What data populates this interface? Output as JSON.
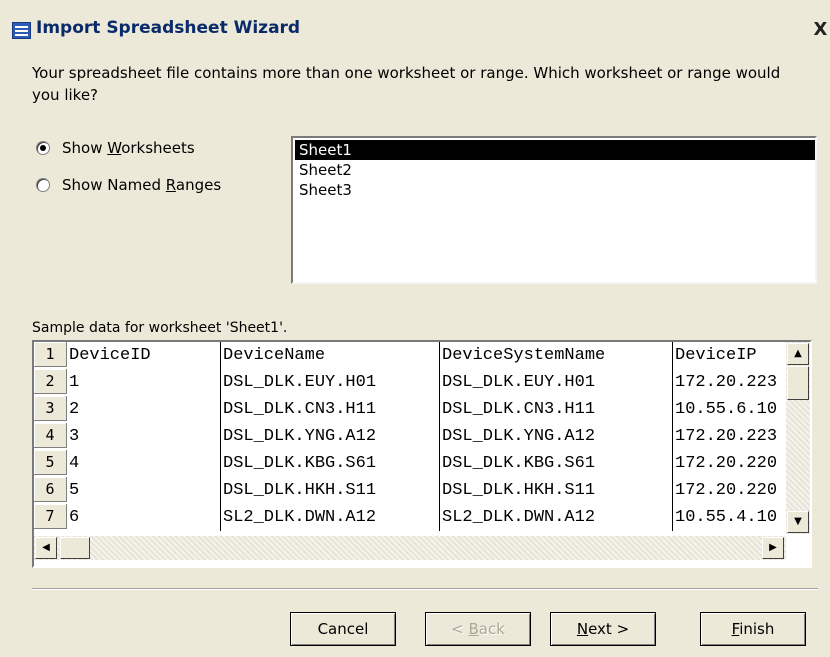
{
  "window": {
    "title": "Import Spreadsheet Wizard",
    "close_label": "X"
  },
  "prompt_text": "Your spreadsheet file contains more than one worksheet or range. Which worksheet or range would you like?",
  "options": {
    "worksheets_pre": "Show ",
    "worksheets_key": "W",
    "worksheets_post": "orksheets",
    "ranges_pre": "Show Named ",
    "ranges_key": "R",
    "ranges_post": "anges",
    "selected": "worksheets"
  },
  "sheets": [
    "Sheet1",
    "Sheet2",
    "Sheet3"
  ],
  "selected_sheet": "Sheet1",
  "sample_label": "Sample data for worksheet 'Sheet1'.",
  "grid": {
    "row_numbers": [
      "1",
      "2",
      "3",
      "4",
      "5",
      "6",
      "7"
    ],
    "rows": [
      [
        "DeviceID",
        "DeviceName",
        "DeviceSystemName",
        "DeviceIP"
      ],
      [
        "1",
        "DSL_DLK.EUY.H01",
        "DSL_DLK.EUY.H01",
        "172.20.223"
      ],
      [
        "2",
        "DSL_DLK.CN3.H11",
        "DSL_DLK.CN3.H11",
        "10.55.6.10"
      ],
      [
        "3",
        "DSL_DLK.YNG.A12",
        "DSL_DLK.YNG.A12",
        "172.20.223"
      ],
      [
        "4",
        "DSL_DLK.KBG.S61",
        "DSL_DLK.KBG.S61",
        "172.20.220"
      ],
      [
        "5",
        "DSL_DLK.HKH.S11",
        "DSL_DLK.HKH.S11",
        "172.20.220"
      ],
      [
        "6",
        "SL2_DLK.DWN.A12",
        "SL2_DLK.DWN.A12",
        "10.55.4.10"
      ]
    ]
  },
  "buttons": {
    "cancel": "Cancel",
    "back_pre": "< ",
    "back_key": "B",
    "back_post": "ack",
    "next_key": "N",
    "next_post": "ext >",
    "finish_key": "F",
    "finish_post": "inish"
  },
  "icons": {
    "title": "table-icon",
    "scroll_up": "arrow-up-icon",
    "scroll_down": "arrow-down-icon",
    "scroll_left": "arrow-left-icon",
    "scroll_right": "arrow-right-icon"
  }
}
